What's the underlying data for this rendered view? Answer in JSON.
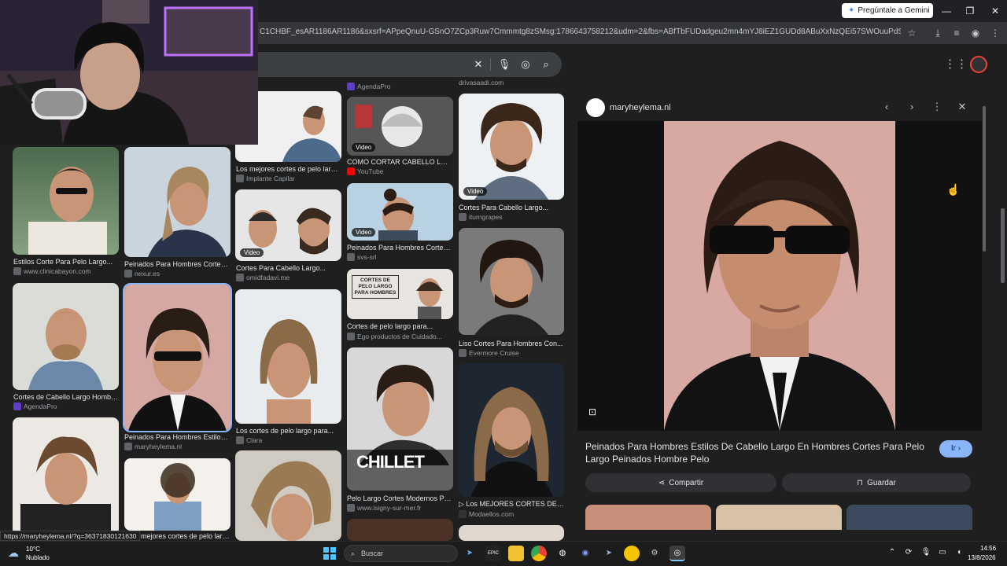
{
  "browser": {
    "gemini_button": "Pregúntale a Gemini",
    "url": "C1CHBF_esAR1186AR1186&sxsrf=APpeQnuU-GSnO7ZCp3Ruw7Cmmmtg8zSMsg:1786643758212&udm=2&fbs=ABfTbFUDadgeu2mn4mYJ8iEZ1GUDd8ABuXxNzQEi57SWOuuPdScLx3oF9c1cFkljSkR..."
  },
  "search": {
    "clear_icon": "close-icon",
    "mic_icon": "mic-icon",
    "lens_icon": "lens-icon",
    "search_icon": "search-icon"
  },
  "results": [
    {
      "caption": "",
      "source": "AgendaPro"
    },
    {
      "caption": "",
      "source": "drivasaadi.com"
    },
    {
      "caption": "Los mejores cortes de pelo largo...",
      "source": "Implante Capilar"
    },
    {
      "caption": "COMO CORTAR CABELLO LARG...",
      "source": "YouTube",
      "badge": "Video"
    },
    {
      "caption": "Cortes Para Cabello Largo...",
      "source": "iturngrapes",
      "badge": "Video"
    },
    {
      "caption": "Estilos Corte Para Pelo Largo...",
      "source": "www.clinicabayon.com"
    },
    {
      "caption": "Peinados Para Hombres Cortes...",
      "source": "nexur.es"
    },
    {
      "caption": "Cortes Para Cabello Largo...",
      "source": "omidfadavi.me",
      "badge": "Video"
    },
    {
      "caption": "Peinados Para Hombres Cortes...",
      "source": "svs-srl",
      "badge": "Video"
    },
    {
      "caption": "Liso Cortes Para Hombres Con...",
      "source": "Evermore Cruise"
    },
    {
      "caption": "Cortes de pelo largo para...",
      "source": "Ego productos de Cuidado..."
    },
    {
      "caption": "Cortes de Cabello Largo Hombre...",
      "source": "AgendaPro"
    },
    {
      "caption": "Peinados Para Hombres Estilos D...",
      "source": "maryheylema.nl"
    },
    {
      "caption": "Los cortes de pelo largo para...",
      "source": "Clara"
    },
    {
      "caption": "Pelo Largo Cortes Modernos Par...",
      "source": "www.isigny-sur-mer.fr"
    },
    {
      "caption": "▷ Los MEJORES CORTES DE PEL...",
      "source": "Modaellos.com"
    },
    {
      "caption": "s mejores cortes de pelo largo...",
      "source": ""
    }
  ],
  "thumb_text": {
    "cortes_overlay": "CORTES DE PELO LARGO PARA HOMBRES",
    "chillet": "CHILLET"
  },
  "panel": {
    "site": "maryheylema.nl",
    "title": "Peinados Para Hombres Estilos De Cabello Largo En Hombres Cortes Para Pelo Largo Peinados Hombre Pelo",
    "go_button": "Ir",
    "share_button": "Compartir",
    "save_button": "Guardar"
  },
  "status_url": "https://maryheylema.nl/?q=36371830121630",
  "taskbar": {
    "weather_temp": "10°C",
    "weather_desc": "Nublado",
    "search_placeholder": "Buscar",
    "time": "14:56",
    "date": "13/8/2026"
  },
  "colors": {
    "accent": "#8ab4f8",
    "panel_bg": "#1f1f1f"
  }
}
